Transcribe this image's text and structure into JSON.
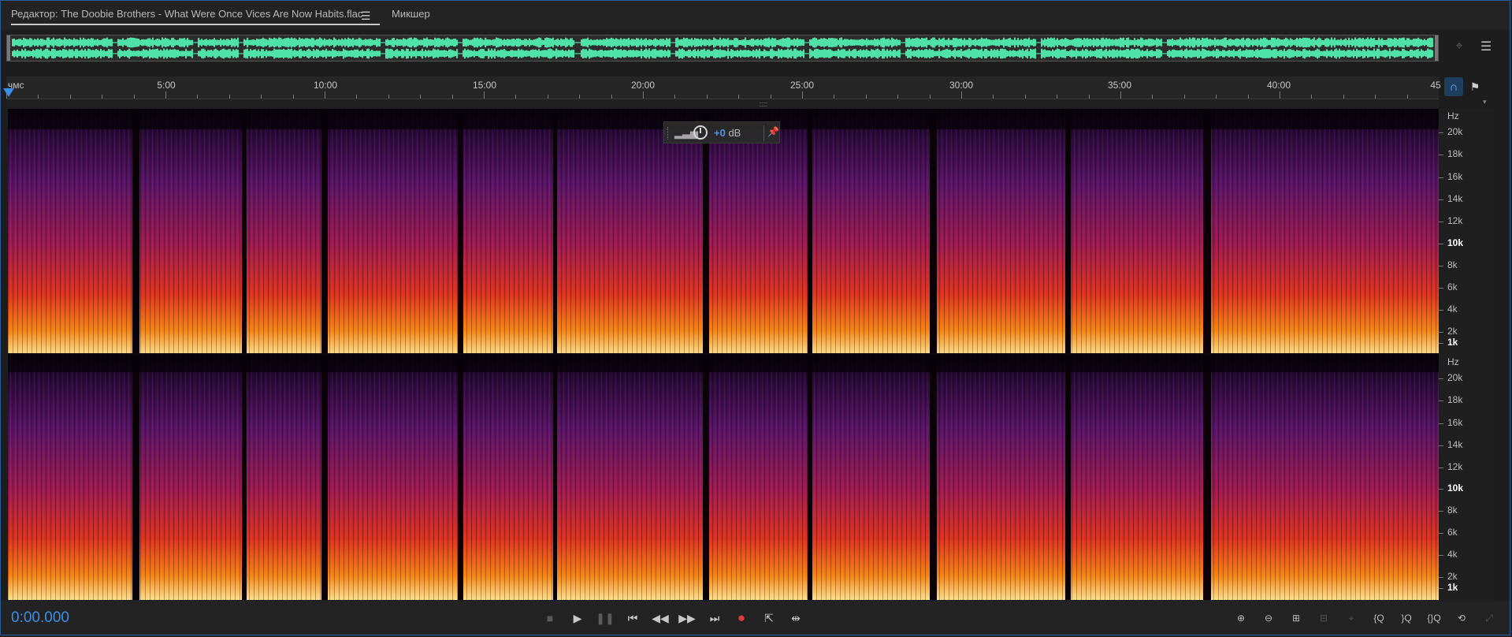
{
  "tabs": {
    "editor_label": "Редактор: The Doobie Brothers - What Were Once Vices Are Now Habits.flac",
    "menu_icon": "hamburger-icon",
    "mixer_label": "Микшер"
  },
  "ruler": {
    "first_label": "чмс",
    "labels": [
      "5:00",
      "10:00",
      "15:00",
      "20:00",
      "25:00",
      "30:00",
      "35:00",
      "40:00",
      "45"
    ]
  },
  "hud": {
    "db_value": "+0",
    "db_unit": "dB"
  },
  "hz_scale": {
    "unit": "Hz",
    "labels": [
      "20k",
      "18k",
      "16k",
      "14k",
      "12k",
      "10k",
      "8k",
      "6k",
      "4k",
      "2k",
      "1k"
    ]
  },
  "transport": {
    "timecode": "0:00.000",
    "buttons": [
      "stop-icon",
      "play-icon",
      "pause-icon",
      "go-to-start-icon",
      "rewind-icon",
      "fast-forward-icon",
      "go-to-end-icon",
      "record-icon",
      "loop-icon",
      "skip-selection-icon"
    ]
  },
  "colors": {
    "accent": "#3b8ee8",
    "waveform": "#4fe2a8",
    "record": "#e23b3b"
  }
}
